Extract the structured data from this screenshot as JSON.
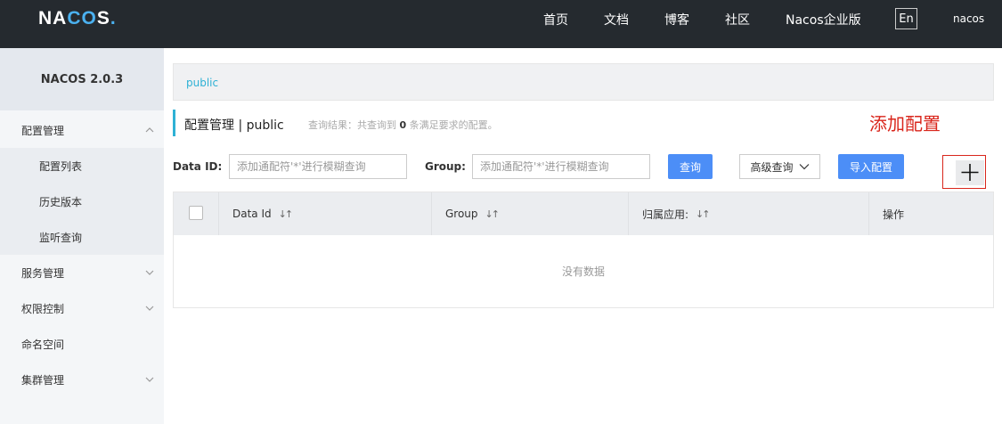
{
  "header": {
    "logo_parts": [
      "NA",
      "CO",
      "S",
      "."
    ],
    "nav": [
      "首页",
      "文档",
      "博客",
      "社区",
      "Nacos企业版"
    ],
    "lang": "En",
    "user": "nacos"
  },
  "sidebar": {
    "title": "NACOS 2.0.3",
    "items": [
      {
        "label": "配置管理",
        "type": "group",
        "expanded": true
      },
      {
        "label": "配置列表",
        "type": "sub"
      },
      {
        "label": "历史版本",
        "type": "sub"
      },
      {
        "label": "监听查询",
        "type": "sub"
      },
      {
        "label": "服务管理",
        "type": "group",
        "expanded": false
      },
      {
        "label": "权限控制",
        "type": "group",
        "expanded": false
      },
      {
        "label": "命名空间",
        "type": "item"
      },
      {
        "label": "集群管理",
        "type": "group",
        "expanded": false
      }
    ]
  },
  "main": {
    "namespace_tab": "public",
    "title": "配置管理 | public",
    "result_prefix": "查询结果：共查询到",
    "result_count": "0",
    "result_suffix": "条满足要求的配置。",
    "annotation": "添加配置",
    "filters": {
      "data_id_label": "Data ID:",
      "data_id_placeholder": "添加通配符'*'进行模糊查询",
      "group_label": "Group:",
      "group_placeholder": "添加通配符'*'进行模糊查询"
    },
    "buttons": {
      "query": "查询",
      "advanced": "高级查询",
      "import": "导入配置"
    },
    "table": {
      "columns": [
        "Data Id",
        "Group",
        "归属应用:",
        "操作"
      ],
      "empty": "没有数据"
    }
  },
  "colors": {
    "topbar": "#252a2f",
    "accent": "#2eb1d5",
    "primary_button": "#4c8ef7",
    "annotation": "#d9261c"
  }
}
